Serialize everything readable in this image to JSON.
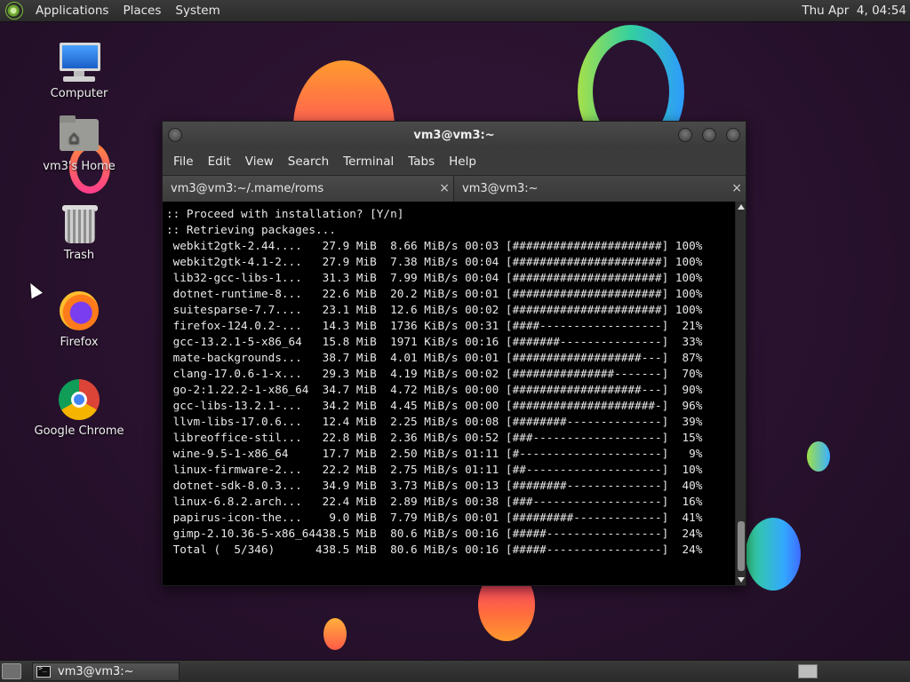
{
  "top_panel": {
    "menus": [
      "Applications",
      "Places",
      "System"
    ],
    "clock": "Thu Apr  4, 04:54"
  },
  "desktop_icons": [
    {
      "label": "Computer",
      "icon": "computer-icon"
    },
    {
      "label": "vm3's Home",
      "icon": "home-folder-icon"
    },
    {
      "label": "Trash",
      "icon": "trash-icon"
    },
    {
      "label": "Firefox",
      "icon": "firefox-icon"
    },
    {
      "label": "Google Chrome",
      "icon": "chrome-icon"
    }
  ],
  "terminal": {
    "title": "vm3@vm3:~",
    "menu": [
      "File",
      "Edit",
      "View",
      "Search",
      "Terminal",
      "Tabs",
      "Help"
    ],
    "tabs": [
      {
        "label": "vm3@vm3:~/.mame/roms",
        "close": "×"
      },
      {
        "label": "vm3@vm3:~",
        "close": "×"
      }
    ],
    "header_lines": [
      ":: Proceed with installation? [Y/n]",
      ":: Retrieving packages..."
    ],
    "downloads": [
      {
        "name": "webkit2gtk-2.44....",
        "size": "27.9 MiB",
        "rate": "8.66 MiB/s",
        "time": "00:03",
        "bar": "[######################]",
        "pct": "100%"
      },
      {
        "name": "webkit2gtk-4.1-2...",
        "size": "27.9 MiB",
        "rate": "7.38 MiB/s",
        "time": "00:04",
        "bar": "[######################]",
        "pct": "100%"
      },
      {
        "name": "lib32-gcc-libs-1...",
        "size": "31.3 MiB",
        "rate": "7.99 MiB/s",
        "time": "00:04",
        "bar": "[######################]",
        "pct": "100%"
      },
      {
        "name": "dotnet-runtime-8...",
        "size": "22.6 MiB",
        "rate": "20.2 MiB/s",
        "time": "00:01",
        "bar": "[######################]",
        "pct": "100%"
      },
      {
        "name": "suitesparse-7.7....",
        "size": "23.1 MiB",
        "rate": "12.6 MiB/s",
        "time": "00:02",
        "bar": "[######################]",
        "pct": "100%"
      },
      {
        "name": "firefox-124.0.2-...",
        "size": "14.3 MiB",
        "rate": "1736 KiB/s",
        "time": "00:31",
        "bar": "[####------------------]",
        "pct": "21%"
      },
      {
        "name": "gcc-13.2.1-5-x86_64",
        "size": "15.8 MiB",
        "rate": "1971 KiB/s",
        "time": "00:16",
        "bar": "[#######---------------]",
        "pct": "33%"
      },
      {
        "name": "mate-backgrounds...",
        "size": "38.7 MiB",
        "rate": "4.01 MiB/s",
        "time": "00:01",
        "bar": "[###################---]",
        "pct": "87%"
      },
      {
        "name": "clang-17.0.6-1-x...",
        "size": "29.3 MiB",
        "rate": "4.19 MiB/s",
        "time": "00:02",
        "bar": "[###############-------]",
        "pct": "70%"
      },
      {
        "name": "go-2:1.22.2-1-x86_64",
        "size": "34.7 MiB",
        "rate": "4.72 MiB/s",
        "time": "00:00",
        "bar": "[###################---]",
        "pct": "90%"
      },
      {
        "name": "gcc-libs-13.2.1-...",
        "size": "34.2 MiB",
        "rate": "4.45 MiB/s",
        "time": "00:00",
        "bar": "[#####################-]",
        "pct": "96%"
      },
      {
        "name": "llvm-libs-17.0.6...",
        "size": "12.4 MiB",
        "rate": "2.25 MiB/s",
        "time": "00:08",
        "bar": "[########--------------]",
        "pct": "39%"
      },
      {
        "name": "libreoffice-stil...",
        "size": "22.8 MiB",
        "rate": "2.36 MiB/s",
        "time": "00:52",
        "bar": "[###-------------------]",
        "pct": "15%"
      },
      {
        "name": "wine-9.5-1-x86_64",
        "size": "17.7 MiB",
        "rate": "2.50 MiB/s",
        "time": "01:11",
        "bar": "[#---------------------]",
        "pct": "9%"
      },
      {
        "name": "linux-firmware-2...",
        "size": "22.2 MiB",
        "rate": "2.75 MiB/s",
        "time": "01:11",
        "bar": "[##--------------------]",
        "pct": "10%"
      },
      {
        "name": "dotnet-sdk-8.0.3...",
        "size": "34.9 MiB",
        "rate": "3.73 MiB/s",
        "time": "00:13",
        "bar": "[########--------------]",
        "pct": "40%"
      },
      {
        "name": "linux-6.8.2.arch...",
        "size": "22.4 MiB",
        "rate": "2.89 MiB/s",
        "time": "00:38",
        "bar": "[###-------------------]",
        "pct": "16%"
      },
      {
        "name": "papirus-icon-the...",
        "size": "9.0 MiB",
        "rate": "7.79 MiB/s",
        "time": "00:01",
        "bar": "[#########-------------]",
        "pct": "41%"
      },
      {
        "name": "gimp-2.10.36-5-x86_64",
        "size": "438.5 MiB",
        "rate": "80.6 MiB/s",
        "time": "00:16",
        "bar": "[#####-----------------]",
        "pct": "24%"
      },
      {
        "name": "Total (  5/346)",
        "size": "438.5 MiB",
        "rate": "80.6 MiB/s",
        "time": "00:16",
        "bar": "[#####-----------------]",
        "pct": "24%"
      }
    ]
  },
  "taskbar": {
    "items": [
      {
        "label": "vm3@vm3:~",
        "icon": "terminal-icon"
      }
    ]
  }
}
